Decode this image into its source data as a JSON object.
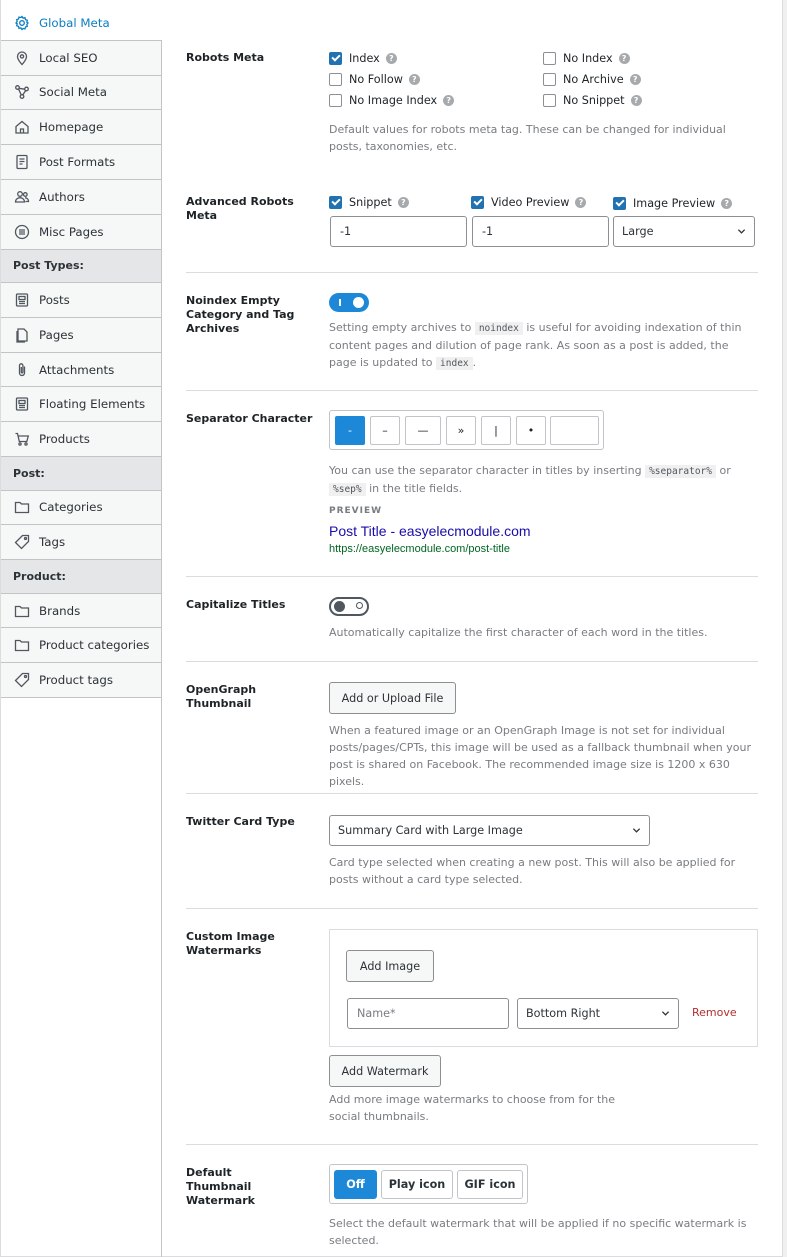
{
  "sidebar": {
    "items": [
      {
        "label": "Global Meta",
        "icon": "gear-icon"
      },
      {
        "label": "Local SEO",
        "icon": "map-pin-icon"
      },
      {
        "label": "Social Meta",
        "icon": "share-icon"
      },
      {
        "label": "Homepage",
        "icon": "home-icon"
      },
      {
        "label": "Post Formats",
        "icon": "document-icon"
      },
      {
        "label": "Authors",
        "icon": "users-icon"
      },
      {
        "label": "Misc Pages",
        "icon": "list-circle-icon"
      }
    ],
    "group_post_types": "Post Types:",
    "post_types": [
      {
        "label": "Posts",
        "icon": "post-icon"
      },
      {
        "label": "Pages",
        "icon": "page-icon"
      },
      {
        "label": "Attachments",
        "icon": "paperclip-icon"
      },
      {
        "label": "Floating Elements",
        "icon": "post-icon"
      },
      {
        "label": "Products",
        "icon": "cart-icon"
      }
    ],
    "group_post": "Post:",
    "post": [
      {
        "label": "Categories",
        "icon": "folder-icon"
      },
      {
        "label": "Tags",
        "icon": "tag-icon"
      }
    ],
    "group_product": "Product:",
    "product": [
      {
        "label": "Brands",
        "icon": "folder-icon"
      },
      {
        "label": "Product categories",
        "icon": "folder-icon"
      },
      {
        "label": "Product tags",
        "icon": "tag-icon"
      }
    ]
  },
  "robots": {
    "label": "Robots Meta",
    "options": [
      {
        "label": "Index",
        "checked": true
      },
      {
        "label": "No Index",
        "checked": false
      },
      {
        "label": "No Follow",
        "checked": false
      },
      {
        "label": "No Archive",
        "checked": false
      },
      {
        "label": "No Image Index",
        "checked": false
      },
      {
        "label": "No Snippet",
        "checked": false
      }
    ],
    "desc": "Default values for robots meta tag. These can be changed for individual posts, taxonomies, etc."
  },
  "advanced": {
    "label": "Advanced Robots Meta",
    "snippet": "Snippet",
    "video": "Video Preview",
    "image": "Image Preview",
    "snippet_value": "-1",
    "video_value": "-1",
    "image_value": "Large"
  },
  "noindex": {
    "label": "Noindex Empty Category and Tag Archives",
    "desc1": "Setting empty archives to",
    "code1": "noindex",
    "desc2": "is useful for avoiding indexation of thin content pages and dilution of page rank. As soon as a post is added, the page is updated to",
    "code2": "index",
    "desc3": "."
  },
  "separator": {
    "label": "Separator Character",
    "options": [
      "-",
      "–",
      "—",
      "»",
      "|",
      "•",
      ""
    ],
    "desc1": "You can use the separator character in titles by inserting",
    "code1": "%separator%",
    "or": "or",
    "code2": "%sep%",
    "desc2": "in the title fields.",
    "preview_label": "PREVIEW",
    "preview_title": "Post Title - easyelecmodule.com",
    "preview_url": "https://easyelecmodule.com/post-title"
  },
  "capitalize": {
    "label": "Capitalize Titles",
    "desc": "Automatically capitalize the first character of each word in the titles."
  },
  "opengraph": {
    "label": "OpenGraph Thumbnail",
    "button": "Add or Upload File",
    "desc": "When a featured image or an OpenGraph Image is not set for individual posts/pages/CPTs, this image will be used as a fallback thumbnail when your post is shared on Facebook. The recommended image size is 1200 x 630 pixels."
  },
  "twitter": {
    "label": "Twitter Card Type",
    "value": "Summary Card with Large Image",
    "desc": "Card type selected when creating a new post. This will also be applied for posts without a card type selected."
  },
  "watermarks": {
    "label": "Custom Image Watermarks",
    "add_image": "Add Image",
    "name_placeholder": "Name*",
    "position": "Bottom Right",
    "remove": "Remove",
    "add_watermark": "Add Watermark",
    "desc": "Add more image watermarks to choose from for the social thumbnails."
  },
  "default_watermark": {
    "label": "Default Thumbnail Watermark",
    "options": [
      "Off",
      "Play icon",
      "GIF icon"
    ],
    "desc": "Select the default watermark that will be applied if no specific watermark is selected."
  }
}
